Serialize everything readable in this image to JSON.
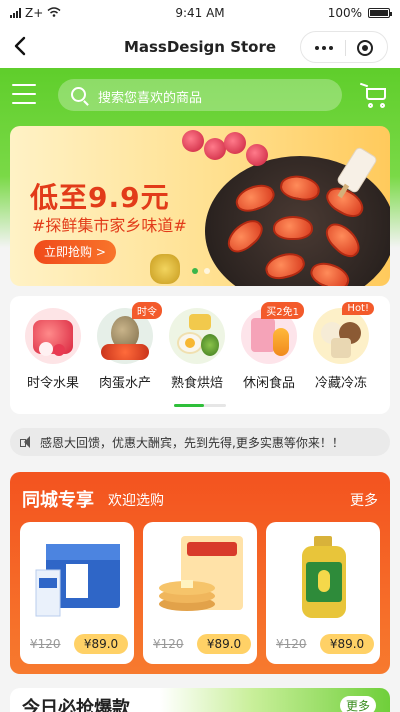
{
  "status": {
    "carrier": "Z+",
    "time": "9:41 AM",
    "battery": "100%"
  },
  "nav": {
    "title": "MassDesign Store"
  },
  "search": {
    "placeholder": "搜索您喜欢的商品"
  },
  "banner": {
    "headline": "低至9.9元",
    "sub": "#探鲜集市家乡味道#",
    "cta": "立即抢购 >"
  },
  "categories": [
    {
      "label": "时令水果",
      "tag": ""
    },
    {
      "label": "肉蛋水产",
      "tag": "时令"
    },
    {
      "label": "熟食烘焙",
      "tag": ""
    },
    {
      "label": "休闲食品",
      "tag": "买2免1"
    },
    {
      "label": "冷藏冷冻",
      "tag": "Hot!"
    }
  ],
  "notice": {
    "text": "感恩大回馈，优惠大酬宾，先到先得,更多实惠等你来！！"
  },
  "city": {
    "title": "同城专享",
    "subtitle": "欢迎选购",
    "more": "更多",
    "products": [
      {
        "old": "¥120",
        "price": "¥89.0"
      },
      {
        "old": "¥120",
        "price": "¥89.0"
      },
      {
        "old": "¥120",
        "price": "¥89.0"
      }
    ]
  },
  "teaser": {
    "title": "今日必抢爆款",
    "more": "更多"
  },
  "colors": {
    "green": "#5fce2b",
    "orange": "#f3531f",
    "red_text": "#e23b19",
    "price_pill": "#ffd166"
  }
}
